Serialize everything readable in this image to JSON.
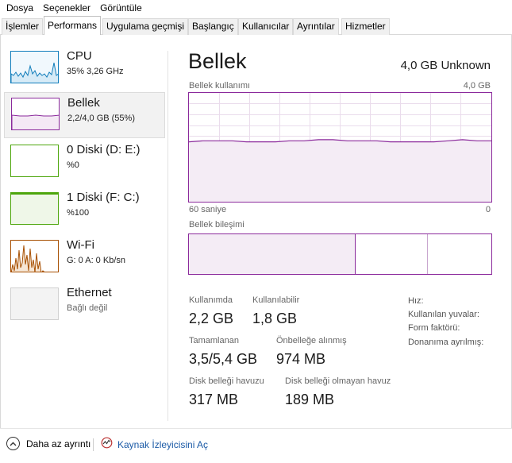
{
  "menu": [
    "Dosya",
    "Seçenekler",
    "Görüntüle"
  ],
  "tabs": [
    "İşlemler",
    "Performans",
    "Uygulama geçmişi",
    "Başlangıç",
    "Kullanıcılar",
    "Ayrıntılar",
    "Hizmetler"
  ],
  "active_tab": "Performans",
  "sidebar": [
    {
      "title": "CPU",
      "sub": "35% 3,26 GHz",
      "color": "#117dbb"
    },
    {
      "title": "Bellek",
      "sub": "2,2/4,0 GB (55%)",
      "color": "#8b2a9c"
    },
    {
      "title": "0 Diski (D: E:)",
      "sub": "%0",
      "color": "#4da60c"
    },
    {
      "title": "1 Diski (F: C:)",
      "sub": "%100",
      "color": "#4da60c"
    },
    {
      "title": "Wi-Fi",
      "sub": "G: 0 A: 0 Kb/sn",
      "color": "#a74f01"
    },
    {
      "title": "Ethernet",
      "sub": "Bağlı değil",
      "color": "#c0c0c0"
    }
  ],
  "panel": {
    "title": "Bellek",
    "total": "4,0 GB Unknown",
    "usage_label": "Bellek kullanımı",
    "usage_max": "4,0 GB",
    "time_left": "60 saniye",
    "time_right": "0",
    "composition_label": "Bellek bileşimi",
    "usage_series": [
      0.55,
      0.56,
      0.56,
      0.56,
      0.55,
      0.55,
      0.55,
      0.56,
      0.56,
      0.57,
      0.57,
      0.56,
      0.56,
      0.56,
      0.55,
      0.55,
      0.55,
      0.55,
      0.56,
      0.57,
      0.56,
      0.56
    ]
  },
  "stats": {
    "in_use_label": "Kullanımda",
    "in_use": "2,2 GB",
    "available_label": "Kullanılabilir",
    "available": "1,8 GB",
    "committed_label": "Tamamlanan",
    "committed": "3,5/5,4 GB",
    "cached_label": "Önbelleğe alınmış",
    "cached": "974 MB",
    "paged_label": "Disk belleği havuzu",
    "paged": "317 MB",
    "nonpaged_label": "Disk belleği olmayan havuz",
    "nonpaged": "189 MB"
  },
  "info": {
    "speed": "Hız:",
    "slots": "Kullanılan yuvalar:",
    "form": "Form faktörü:",
    "reserved": "Donanıma ayrılmış:"
  },
  "footer": {
    "less": "Daha az ayrıntı",
    "monitor": "Kaynak İzleyicisini Aç"
  }
}
